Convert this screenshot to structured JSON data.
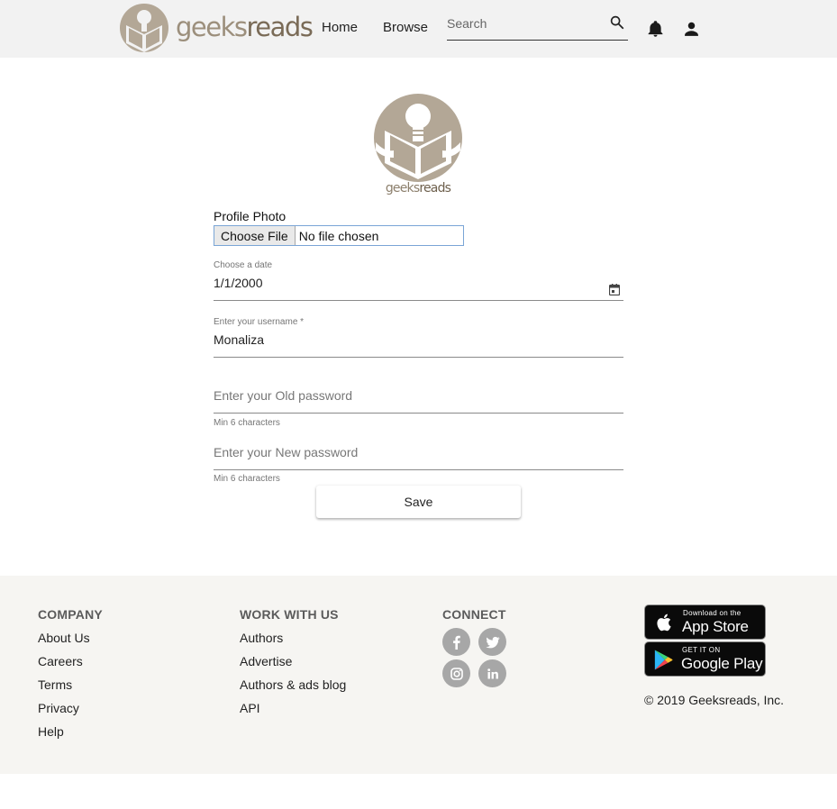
{
  "header": {
    "brand": {
      "part1": "geeks",
      "part2": "reads"
    },
    "nav": [
      {
        "label": "Home"
      },
      {
        "label": "Browse"
      }
    ],
    "search": {
      "placeholder": "Search",
      "value": ""
    },
    "icons": [
      "search-icon",
      "bell-icon",
      "account-icon"
    ]
  },
  "form": {
    "logo": {
      "part1": "geeks",
      "part2": "reads"
    },
    "profile_photo": {
      "label": "Profile Photo",
      "button_label": "Choose File",
      "status": "No file chosen"
    },
    "date": {
      "label": "Choose a date",
      "value": "1/1/2000",
      "icon": "calendar-icon"
    },
    "username": {
      "label": "Enter your username *",
      "value": "Monaliza"
    },
    "old_password": {
      "placeholder": "Enter your Old password",
      "hint": "Min 6 characters"
    },
    "new_password": {
      "placeholder": "Enter your New password",
      "hint": "Min 6 characters"
    },
    "save_label": "Save"
  },
  "footer": {
    "company": {
      "title": "COMPANY",
      "links": [
        "About Us",
        "Careers",
        "Terms",
        "Privacy",
        "Help"
      ]
    },
    "work": {
      "title": "WORK WITH US",
      "links": [
        "Authors",
        "Advertise",
        "Authors & ads blog",
        "API"
      ]
    },
    "connect": {
      "title": "CONNECT",
      "icons": [
        "facebook-icon",
        "twitter-icon",
        "instagram-icon",
        "linkedin-icon"
      ]
    },
    "app_store": {
      "small": "Download on the",
      "big": "App Store"
    },
    "google_play": {
      "small": "GET IT ON",
      "big": "Google Play"
    },
    "copyright": "© 2019 Geeksreads, Inc."
  },
  "colors": {
    "brand": "#9c8f7c",
    "header_bg": "#f2f2f2",
    "footer_bg": "#f6f5f2",
    "social_icon_bg": "#a7a7a7"
  }
}
